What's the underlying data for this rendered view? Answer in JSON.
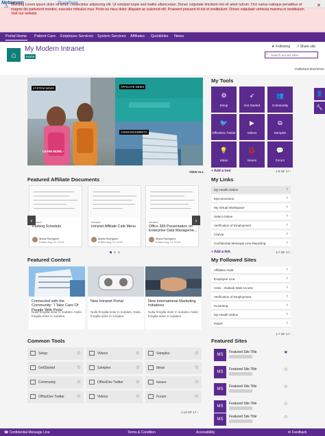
{
  "topbar": {
    "logo": "Netweven",
    "app": "SharePoint"
  },
  "banner": {
    "text": "Warning Lorem ipsum dolor sit amet, consectetur adipiscing elit. Ut volutpat turpis sed mattis ullamcorper. Donec vulputate tincidunt nisi sit amet rutrum. Orci varius natoque penatibus et magnis dis parturient montes, nascetur ridiculus mus. Proin eu risus dolor. Aliquam ac euismod elit. Praesent posuere id est et vestibulum. Donec vulputate vehicula maxima in vestibulum. Visit our website",
    "icon": "warning-icon"
  },
  "nav": {
    "items": [
      "Portal Home",
      "Patient Care",
      "Employee Services",
      "System Services",
      "Affiliates",
      "Quicklinks",
      "News"
    ]
  },
  "header": {
    "title": "My Modern Intranet",
    "breadcrumb": "Home",
    "following": "Following",
    "share": "Share site",
    "search_placeholder": "Search across sites",
    "published": "Published 8/22/2018"
  },
  "hero": {
    "tags": [
      "SYSTEM NEWS",
      "AFFILIATE NEWS",
      "ANNOUNCEMENTS"
    ],
    "learn_more": "LEARN MORE ›",
    "view_all": "VIEW ALL"
  },
  "affiliate_docs": {
    "title": "Featured Affiliate Documents",
    "cards": [
      {
        "site": "Intranet",
        "title": "Parking Schedule",
        "author": "Maria Rodriguez",
        "date": "Edited Aug 24, 2018"
      },
      {
        "site": "Intranet",
        "title": "Intranet Affiliate Cafe Menu",
        "author": "Maria Rodriguez",
        "date": "Edited Aug 24, 2018"
      },
      {
        "site": "Intranet",
        "title": "Office 365 Presentation on Enterprise Data Manageme...",
        "author": "Maria Rodriguez",
        "date": "Edited Aug 24, 2018"
      }
    ]
  },
  "featured_content": {
    "title": "Featured Content",
    "cards": [
      {
        "title": "Connected with the Community: 'I Take Care Of People With Pride'",
        "body": "Nulla fringilla dolor in sodales. Nulla fringilla dolor in sodales."
      },
      {
        "title": "New Intranet Portal",
        "body": "Nulla fringilla dolor in sodales. Nulla fringilla dolor in sodales."
      },
      {
        "title": "New International Marketing Initiatives",
        "body": "Nulla fringilla dolor in sodales. Nulla fringilla dolor in sodales."
      }
    ]
  },
  "common_tools": {
    "title": "Common Tools",
    "items": [
      "Setup",
      "Videos",
      "Samples",
      "GetStarted",
      "Samples",
      "Ideas",
      "Community",
      "OfficeDev Twitter",
      "Issues",
      "OfficeDev Twitter",
      "Videos",
      "Forum"
    ],
    "pager": "1-12 OF 17"
  },
  "my_tools": {
    "title": "My Tools",
    "items": [
      {
        "label": "Setup",
        "icon": "gear-icon",
        "glyph": "⚙"
      },
      {
        "label": "Get Started",
        "icon": "rocket-icon",
        "glyph": "➶"
      },
      {
        "label": "Community",
        "icon": "people-icon",
        "glyph": "👥"
      },
      {
        "label": "OfficeDev Twitter",
        "icon": "twitter-icon",
        "glyph": "🐦"
      },
      {
        "label": "Videos",
        "icon": "video-icon",
        "glyph": "▶"
      },
      {
        "label": "Samples",
        "icon": "samples-icon",
        "glyph": "⧉"
      },
      {
        "label": "Ideas",
        "icon": "lightbulb-icon",
        "glyph": "💡"
      },
      {
        "label": "Issues",
        "icon": "bug-icon",
        "glyph": "🐞"
      },
      {
        "label": "Forum",
        "icon": "forum-icon",
        "glyph": "💬"
      }
    ],
    "add": "+ Add a tool",
    "pager": "1-9 OF 17"
  },
  "my_links": {
    "title": "My Links",
    "items": [
      "My Health Online",
      "MyConnection",
      "My Virtual Workspace",
      "Select Online",
      "Verification of Employment",
      "Clarvia",
      "Confidential Message Line Reporting"
    ],
    "add": "+ Add a link",
    "pager": "1-7 OF 17"
  },
  "followed_sites": {
    "title": "My Followed Sites",
    "items": [
      "Affiliates HUB",
      "Employee Line",
      "Citrix - Outlook Web Access",
      "Verification of Employment",
      "eLearning",
      "My Health Online",
      "PSDP"
    ],
    "pager": "1-7 OF 17"
  },
  "featured_sites": {
    "title": "Featured Sites",
    "items": [
      {
        "badge": "MS",
        "title": "Featured Site Title"
      },
      {
        "badge": "MS",
        "title": "Featured Site Title"
      },
      {
        "badge": "MS",
        "title": "Featured Site Title"
      },
      {
        "badge": "MS",
        "title": "Featured Site Title"
      },
      {
        "badge": "MS",
        "title": "Featured Site Title"
      }
    ]
  },
  "footer": {
    "items": [
      "Confidential Message Line",
      "Terms & Condition",
      "Accessibility",
      "Feedback"
    ]
  },
  "colors": {
    "brand": "#5b2a8e",
    "teal": "#0f7f79",
    "banner_bg": "#fbdede",
    "banner_text": "#a80000"
  }
}
